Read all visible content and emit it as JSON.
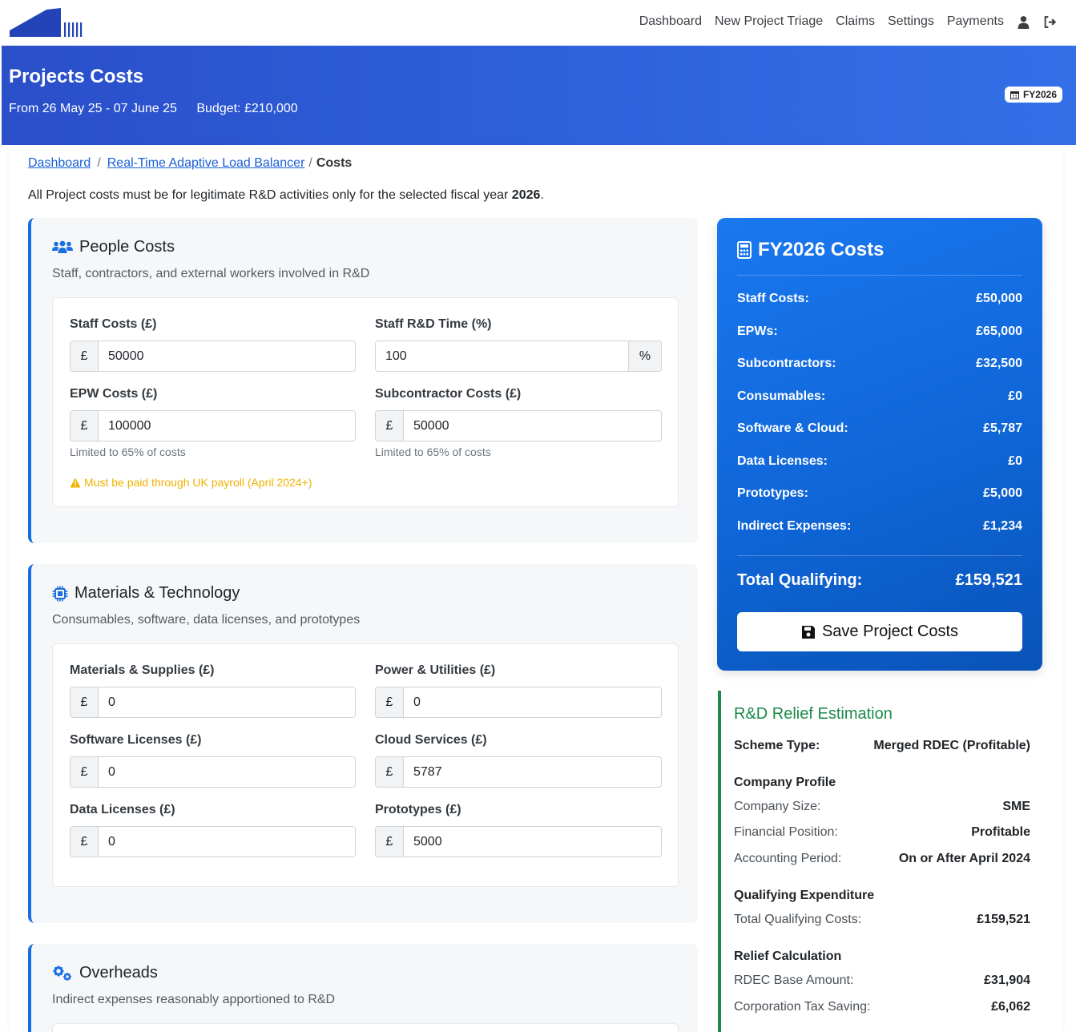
{
  "nav": {
    "links": [
      "Dashboard",
      "New Project Triage",
      "Claims",
      "Settings",
      "Payments"
    ],
    "user_icon": "user-icon",
    "logout_icon": "sign-out-icon"
  },
  "header": {
    "title": "Projects Costs",
    "date_range": "From 26 May 25 - 07 June 25",
    "budget": "Budget: £210,000",
    "fy_badge": "FY2026"
  },
  "breadcrumb": {
    "items": [
      "Dashboard",
      "Real-Time Adaptive Load Balancer"
    ],
    "separator": "/",
    "current": "Costs"
  },
  "notice": {
    "text": "All Project costs must be for legitimate R&D activities only for the selected fiscal year ",
    "year": "2026",
    "end": "."
  },
  "people": {
    "title": "People Costs",
    "desc": "Staff, contractors, and external workers involved in R&D",
    "staff_label": "Staff Costs (£)",
    "staff_value": "50000",
    "time_label": "Staff R&D Time (%)",
    "time_value": "100",
    "epw_label": "EPW Costs (£)",
    "epw_value": "100000",
    "epw_help": "Limited to 65% of costs",
    "sub_label": "Subcontractor Costs (£)",
    "sub_value": "50000",
    "sub_help": "Limited to 65% of costs",
    "warning": "Must be paid through UK payroll (April 2024+)"
  },
  "materials": {
    "title": "Materials & Technology",
    "desc": "Consumables, software, data licenses, and prototypes",
    "materials_label": "Materials & Supplies (£)",
    "materials_value": "0",
    "power_label": "Power & Utilities (£)",
    "power_value": "0",
    "software_label": "Software Licenses (£)",
    "software_value": "0",
    "cloud_label": "Cloud Services (£)",
    "cloud_value": "5787",
    "data_label": "Data Licenses (£)",
    "data_value": "0",
    "proto_label": "Prototypes (£)",
    "proto_value": "5000"
  },
  "overheads": {
    "title": "Overheads",
    "desc": "Indirect expenses reasonably apportioned to R&D"
  },
  "currency_symbol": "£",
  "percent_symbol": "%",
  "costs": {
    "title": "FY2026 Costs",
    "rows": [
      {
        "label": "Staff Costs:",
        "value": "£50,000"
      },
      {
        "label": "EPWs:",
        "value": "£65,000"
      },
      {
        "label": "Subcontractors:",
        "value": "£32,500"
      },
      {
        "label": "Consumables:",
        "value": "£0"
      },
      {
        "label": "Software & Cloud:",
        "value": "£5,787"
      },
      {
        "label": "Data Licenses:",
        "value": "£0"
      },
      {
        "label": "Prototypes:",
        "value": "£5,000"
      },
      {
        "label": "Indirect Expenses:",
        "value": "£1,234"
      }
    ],
    "total_label": "Total Qualifying:",
    "total_value": "£159,521",
    "save_label": "Save Project Costs"
  },
  "relief": {
    "title": "R&D Relief Estimation",
    "scheme_label": "Scheme Type:",
    "scheme_value": "Merged RDEC (Profitable)",
    "company_heading": "Company Profile",
    "size_label": "Company Size:",
    "size_value": "SME",
    "position_label": "Financial Position:",
    "position_value": "Profitable",
    "period_label": "Accounting Period:",
    "period_value": "On or After April 2024",
    "qe_heading": "Qualifying Expenditure",
    "total_label": "Total Qualifying Costs:",
    "total_value": "£159,521",
    "calc_heading": "Relief Calculation",
    "base_label": "RDEC Base Amount:",
    "base_value": "£31,904",
    "tax_label": "Corporation Tax Saving:",
    "tax_value": "£6,062"
  },
  "colors": {
    "banner": "#2f63de",
    "accent": "#1a6fe0",
    "relief_green": "#1b8a4a",
    "warning": "#f0b100"
  }
}
